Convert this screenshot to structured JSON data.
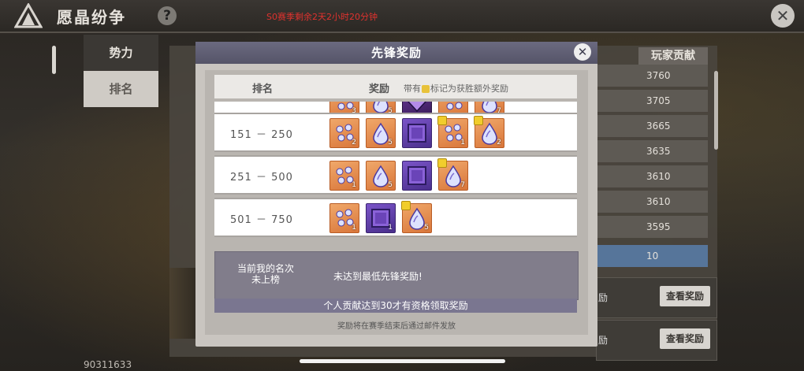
{
  "app": {
    "title": "愿晶纷争",
    "help": "?",
    "season_timer": "S0赛季剩余2天2小时20分钟",
    "close": "✕"
  },
  "sidebar": {
    "tabs": [
      {
        "label": "势力"
      },
      {
        "label": "排名"
      }
    ]
  },
  "ranking": {
    "column_header": "玩家贡献",
    "scores": [
      "3760",
      "3705",
      "3665",
      "3635",
      "3610",
      "3610",
      "3595",
      "10"
    ],
    "reward_rows": [
      {
        "label": "励",
        "button": "查看奖励"
      },
      {
        "label": "励",
        "button": "查看奖励"
      }
    ]
  },
  "user_id": "90311633",
  "modal": {
    "title": "先锋奖励",
    "close": "✕",
    "table_header": {
      "rank": "排名",
      "reward": "奖励",
      "note_prefix": "带有",
      "note_suffix": "标记为获胜额外奖励"
    },
    "rows": [
      {
        "rank": "",
        "items": [
          {
            "kind": "orange",
            "icon": "crystal-cluster-icon",
            "qty": "3",
            "bonus": false
          },
          {
            "kind": "orange",
            "icon": "crystal-drop-icon",
            "qty": "5",
            "bonus": false
          },
          {
            "kind": "dark",
            "icon": "dark-crystal-icon",
            "qty": "",
            "bonus": false
          },
          {
            "kind": "orange",
            "icon": "crystal-cluster-icon",
            "qty": "",
            "bonus": false
          },
          {
            "kind": "orange",
            "icon": "crystal-drop-icon",
            "qty": "7",
            "bonus": false
          }
        ]
      },
      {
        "rank": "151 － 250",
        "items": [
          {
            "kind": "orange",
            "icon": "crystal-cluster-icon",
            "qty": "2",
            "bonus": false
          },
          {
            "kind": "orange",
            "icon": "crystal-drop-icon",
            "qty": "5",
            "bonus": false
          },
          {
            "kind": "purple",
            "icon": "purple-frame-icon",
            "qty": "",
            "bonus": false
          },
          {
            "kind": "orange",
            "icon": "crystal-cluster-icon",
            "qty": "1",
            "bonus": true
          },
          {
            "kind": "orange",
            "icon": "crystal-drop-icon",
            "qty": "2",
            "bonus": true
          }
        ]
      },
      {
        "rank": "251 － 500",
        "items": [
          {
            "kind": "orange",
            "icon": "crystal-cluster-icon",
            "qty": "1",
            "bonus": false
          },
          {
            "kind": "orange",
            "icon": "crystal-drop-icon",
            "qty": "5",
            "bonus": false
          },
          {
            "kind": "purple",
            "icon": "purple-frame-icon",
            "qty": "",
            "bonus": false
          },
          {
            "kind": "orange",
            "icon": "crystal-drop-icon",
            "qty": "7",
            "bonus": true
          }
        ]
      },
      {
        "rank": "501 － 750",
        "items": [
          {
            "kind": "orange",
            "icon": "crystal-cluster-icon",
            "qty": "1",
            "bonus": false
          },
          {
            "kind": "purple",
            "icon": "purple-frame-icon",
            "qty": "1",
            "bonus": false
          },
          {
            "kind": "orange",
            "icon": "crystal-drop-icon",
            "qty": "5",
            "bonus": true
          }
        ]
      }
    ],
    "status": {
      "rank_line1": "当前我的名次",
      "rank_line2": "未上榜",
      "message": "未达到最低先锋奖励!"
    },
    "requirement": "个人贡献达到30才有资格领取奖励",
    "footnote": "奖励将在赛季结束后通过邮件发放"
  }
}
